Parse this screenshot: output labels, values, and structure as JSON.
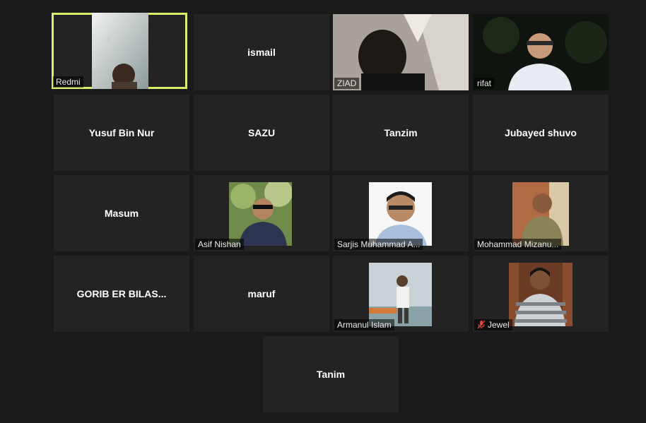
{
  "participants": [
    {
      "name": "Redmi"
    },
    {
      "name": "ismail"
    },
    {
      "name": "ZIAD"
    },
    {
      "name": "rifat"
    },
    {
      "name": "Yusuf Bin Nur"
    },
    {
      "name": "SAZU"
    },
    {
      "name": "Tanzim"
    },
    {
      "name": "Jubayed shuvo"
    },
    {
      "name": "Masum"
    },
    {
      "name": "Asif Nishan"
    },
    {
      "name": "Sarjis Muhammad A..."
    },
    {
      "name": "Mohammad Mizanu..."
    },
    {
      "name": "GORIB ER BILAS..."
    },
    {
      "name": "maruf"
    },
    {
      "name": "Armanul Islam"
    },
    {
      "name": "Jewel"
    },
    {
      "name": "Tanim"
    }
  ],
  "colors": {
    "active_speaker_border": "#d9ec6b",
    "muted_icon": "#e0453a"
  }
}
